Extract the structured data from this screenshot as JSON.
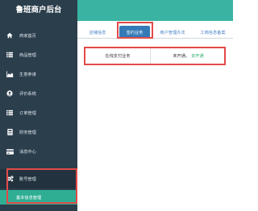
{
  "sidebar": {
    "title": "鲁班商户后台",
    "items": [
      {
        "label": "商家首页",
        "icon": "home-icon"
      },
      {
        "label": "商品管理",
        "icon": "list-icon"
      },
      {
        "label": "生意参谋",
        "icon": "area-chart-icon"
      },
      {
        "label": "评价系统",
        "icon": "user-circle-icon"
      },
      {
        "label": "订单管理",
        "icon": "list-icon"
      },
      {
        "label": "财务管理",
        "icon": "calculator-icon"
      },
      {
        "label": "消息中心",
        "icon": "credit-card-icon"
      },
      {
        "label": "账号管理",
        "icon": "gears-icon"
      }
    ],
    "active_sub_item": "基本信息管理"
  },
  "tabs": [
    {
      "label": "店铺信息"
    },
    {
      "label": "签约业务",
      "active": true
    },
    {
      "label": "商户管理办法"
    },
    {
      "label": "工商信息备案"
    }
  ],
  "content": {
    "business_label": "在线支付业务",
    "status_text": "未开通。",
    "status_link": "去开通"
  },
  "colors": {
    "sidebar_bg": "#2b3e4c",
    "topbar": "#3ab3a3",
    "active_tab": "#337ab7",
    "sub_item": "#2fae93",
    "highlight": "#e34a48",
    "link": "#2eaa6b"
  }
}
